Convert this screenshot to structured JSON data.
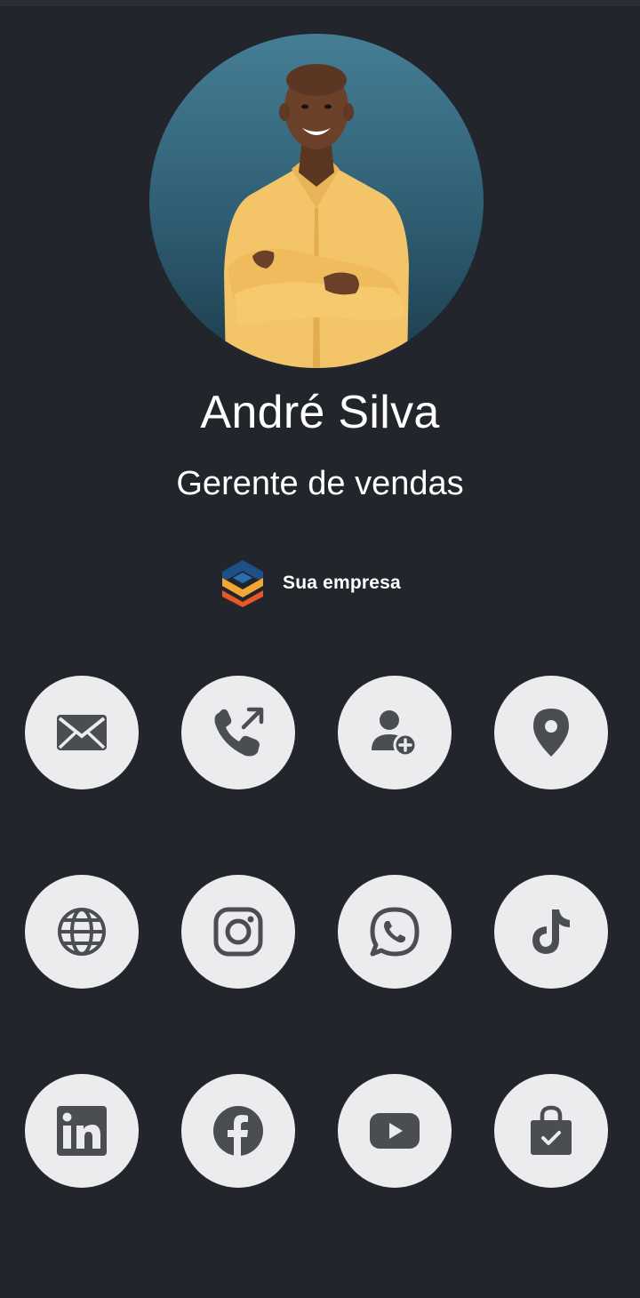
{
  "profile": {
    "name": "André Silva",
    "role": "Gerente de vendas"
  },
  "company": {
    "name": "Sua empresa",
    "logo_colors": [
      "#1e4f86",
      "#f2a633",
      "#e8572a"
    ]
  },
  "actions": [
    {
      "id": "email",
      "icon": "envelope-icon"
    },
    {
      "id": "phone",
      "icon": "phone-outgoing-icon"
    },
    {
      "id": "add-contact",
      "icon": "user-plus-icon"
    },
    {
      "id": "location",
      "icon": "map-pin-icon"
    },
    {
      "id": "website",
      "icon": "globe-icon"
    },
    {
      "id": "instagram",
      "icon": "instagram-icon"
    },
    {
      "id": "whatsapp",
      "icon": "whatsapp-icon"
    },
    {
      "id": "tiktok",
      "icon": "tiktok-icon"
    },
    {
      "id": "linkedin",
      "icon": "linkedin-icon"
    },
    {
      "id": "facebook",
      "icon": "facebook-icon"
    },
    {
      "id": "youtube",
      "icon": "youtube-icon"
    },
    {
      "id": "shop",
      "icon": "shopping-bag-icon"
    }
  ],
  "colors": {
    "background": "#22252b",
    "button": "#ececef",
    "icon": "#4a4d52",
    "text": "#ffffff"
  }
}
